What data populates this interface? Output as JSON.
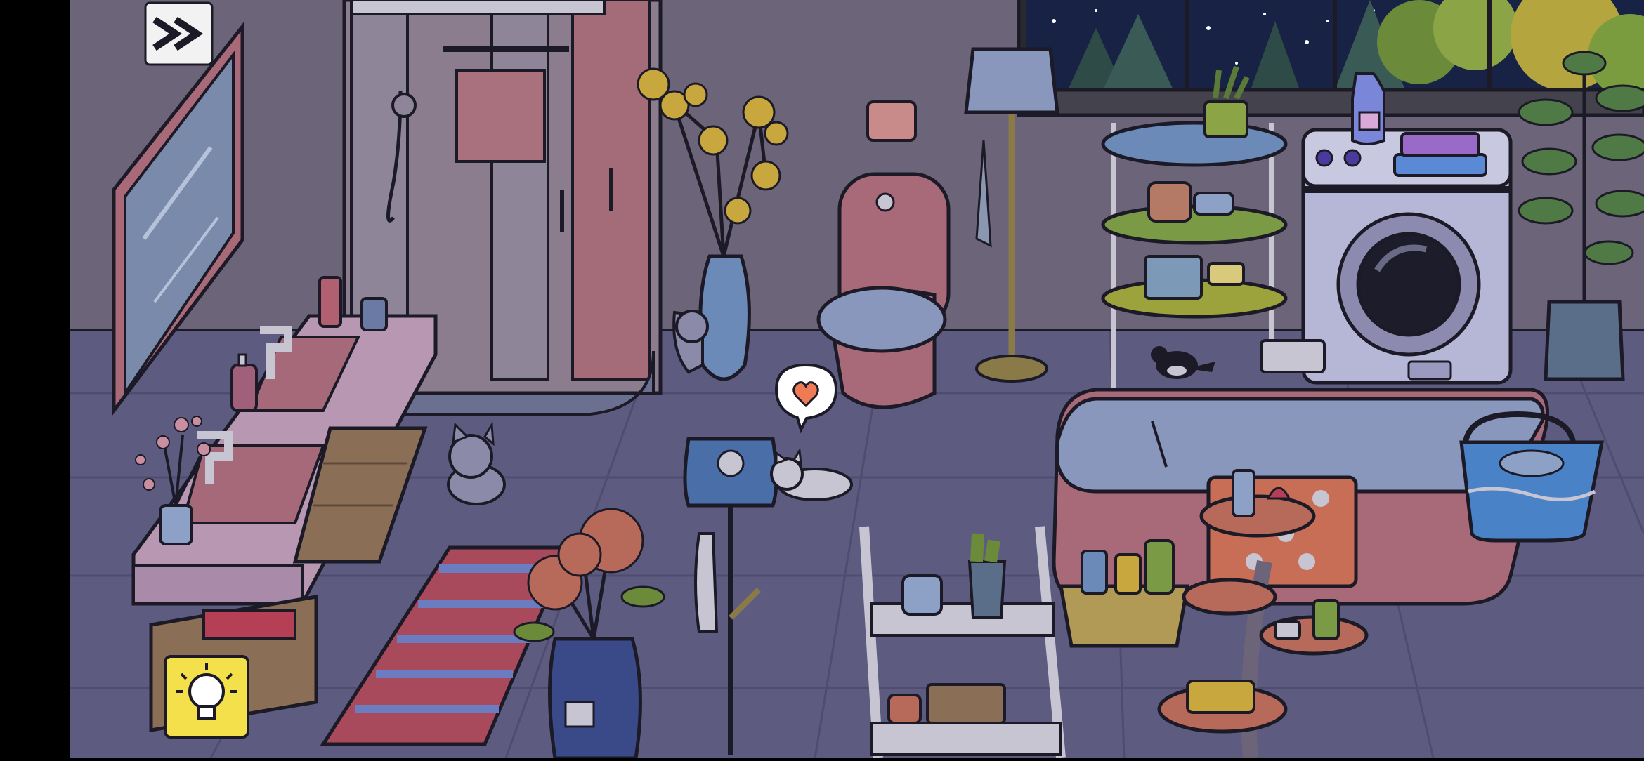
{
  "game": {
    "scene": "bathroom-night",
    "palette": {
      "outline": "#1b1a26",
      "wall": "#6c6478",
      "floor": "#5e5b80",
      "grout": "#4f4c70",
      "night_sky": "#172244",
      "accent_pink": "#b0606a",
      "lamp_blue": "#6f84b4",
      "hint_yellow": "#f4e04a"
    },
    "controls": {
      "fast_forward": {
        "icon": "fast-forward-icon"
      },
      "hint": {
        "icon": "lightbulb-icon"
      }
    },
    "thought_bubble": {
      "icon": "heart-icon",
      "color": "#ef7a56"
    }
  }
}
